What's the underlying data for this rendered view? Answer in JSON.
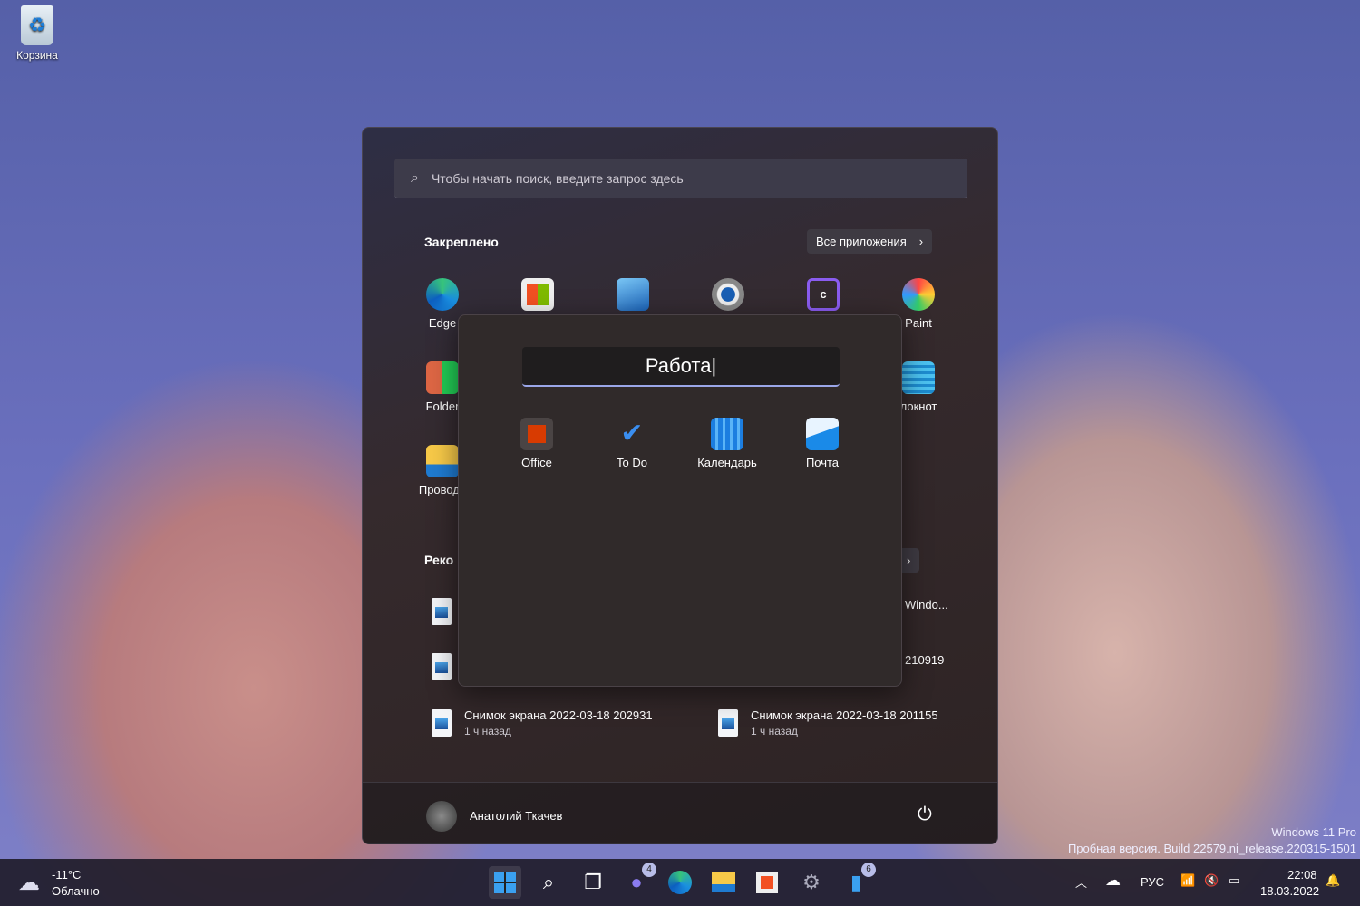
{
  "desktop": {
    "recycle_bin": "Корзина",
    "watermark": {
      "line1": "Windows 11 Pro",
      "line2": "Пробная версия. Build 22579.ni_release.220315-1501"
    }
  },
  "start": {
    "search_placeholder": "Чтобы начать поиск, введите запрос здесь",
    "pinned_title": "Закреплено",
    "all_apps": "Все приложения",
    "pinned": [
      {
        "label": "Edge"
      },
      {
        "label": ""
      },
      {
        "label": ""
      },
      {
        "label": ""
      },
      {
        "label": ""
      },
      {
        "label": "Paint"
      },
      {
        "label": "Folder"
      },
      {
        "label": "локнот"
      },
      {
        "label": "Проводн"
      }
    ],
    "recommended_title": "Реко",
    "recommended": [
      {
        "name": "Windo...",
        "time": ""
      },
      {
        "name": "210919",
        "time": ""
      },
      {
        "name": "Снимок экрана 2022-03-18 202931",
        "time": "1 ч назад"
      },
      {
        "name": "Снимок экрана 2022-03-18 201155",
        "time": "1 ч назад"
      }
    ],
    "user": "Анатолий Ткачев"
  },
  "folder": {
    "name": "Работа",
    "apps": [
      {
        "label": "Office"
      },
      {
        "label": "To Do"
      },
      {
        "label": "Календарь"
      },
      {
        "label": "Почта"
      }
    ]
  },
  "taskbar": {
    "weather": {
      "temp": "-11°C",
      "cond": "Облачно"
    },
    "badges": {
      "teams": "4",
      "phone": "6"
    },
    "lang": "РУС",
    "time": "22:08",
    "date": "18.03.2022"
  }
}
